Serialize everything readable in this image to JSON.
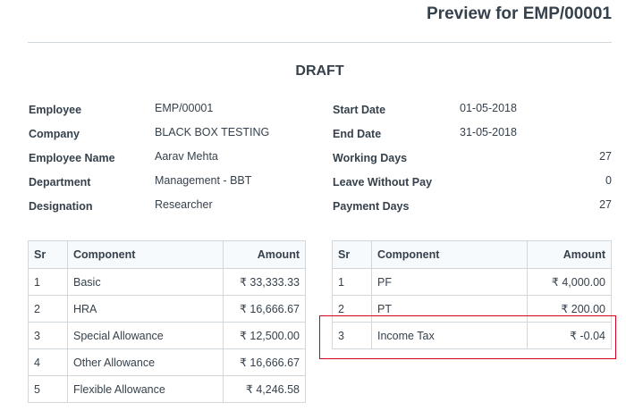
{
  "header": {
    "title": "Preview for EMP/00001"
  },
  "status": "DRAFT",
  "info_left": [
    {
      "label": "Employee",
      "value": "EMP/00001"
    },
    {
      "label": "Company",
      "value": "BLACK BOX TESTING"
    },
    {
      "label": "Employee Name",
      "value": "Aarav Mehta"
    },
    {
      "label": "Department",
      "value": "Management - BBT"
    },
    {
      "label": "Designation",
      "value": "Researcher"
    }
  ],
  "info_right": [
    {
      "label": "Start Date",
      "value": "01-05-2018"
    },
    {
      "label": "End Date",
      "value": "31-05-2018"
    },
    {
      "label": "Working Days",
      "value": "27"
    },
    {
      "label": "Leave Without Pay",
      "value": "0"
    },
    {
      "label": "Payment Days",
      "value": "27"
    }
  ],
  "earnings": {
    "headers": {
      "sr": "Sr",
      "component": "Component",
      "amount": "Amount"
    },
    "rows": [
      {
        "sr": "1",
        "component": "Basic",
        "amount": "₹ 33,333.33"
      },
      {
        "sr": "2",
        "component": "HRA",
        "amount": "₹ 16,666.67"
      },
      {
        "sr": "3",
        "component": "Special Allowance",
        "amount": "₹ 12,500.00"
      },
      {
        "sr": "4",
        "component": "Other Allowance",
        "amount": "₹ 16,666.67"
      },
      {
        "sr": "5",
        "component": "Flexible Allowance",
        "amount": "₹ 4,246.58"
      }
    ]
  },
  "deductions": {
    "headers": {
      "sr": "Sr",
      "component": "Component",
      "amount": "Amount"
    },
    "rows": [
      {
        "sr": "1",
        "component": "PF",
        "amount": "₹ 4,000.00"
      },
      {
        "sr": "2",
        "component": "PT",
        "amount": "₹ 200.00"
      },
      {
        "sr": "3",
        "component": "Income Tax",
        "amount": "₹ -0.04"
      }
    ]
  },
  "colors": {
    "highlight": "#d0021b",
    "border": "#d1d8dd",
    "header_bg": "#f7fafc",
    "text": "#36414c"
  }
}
